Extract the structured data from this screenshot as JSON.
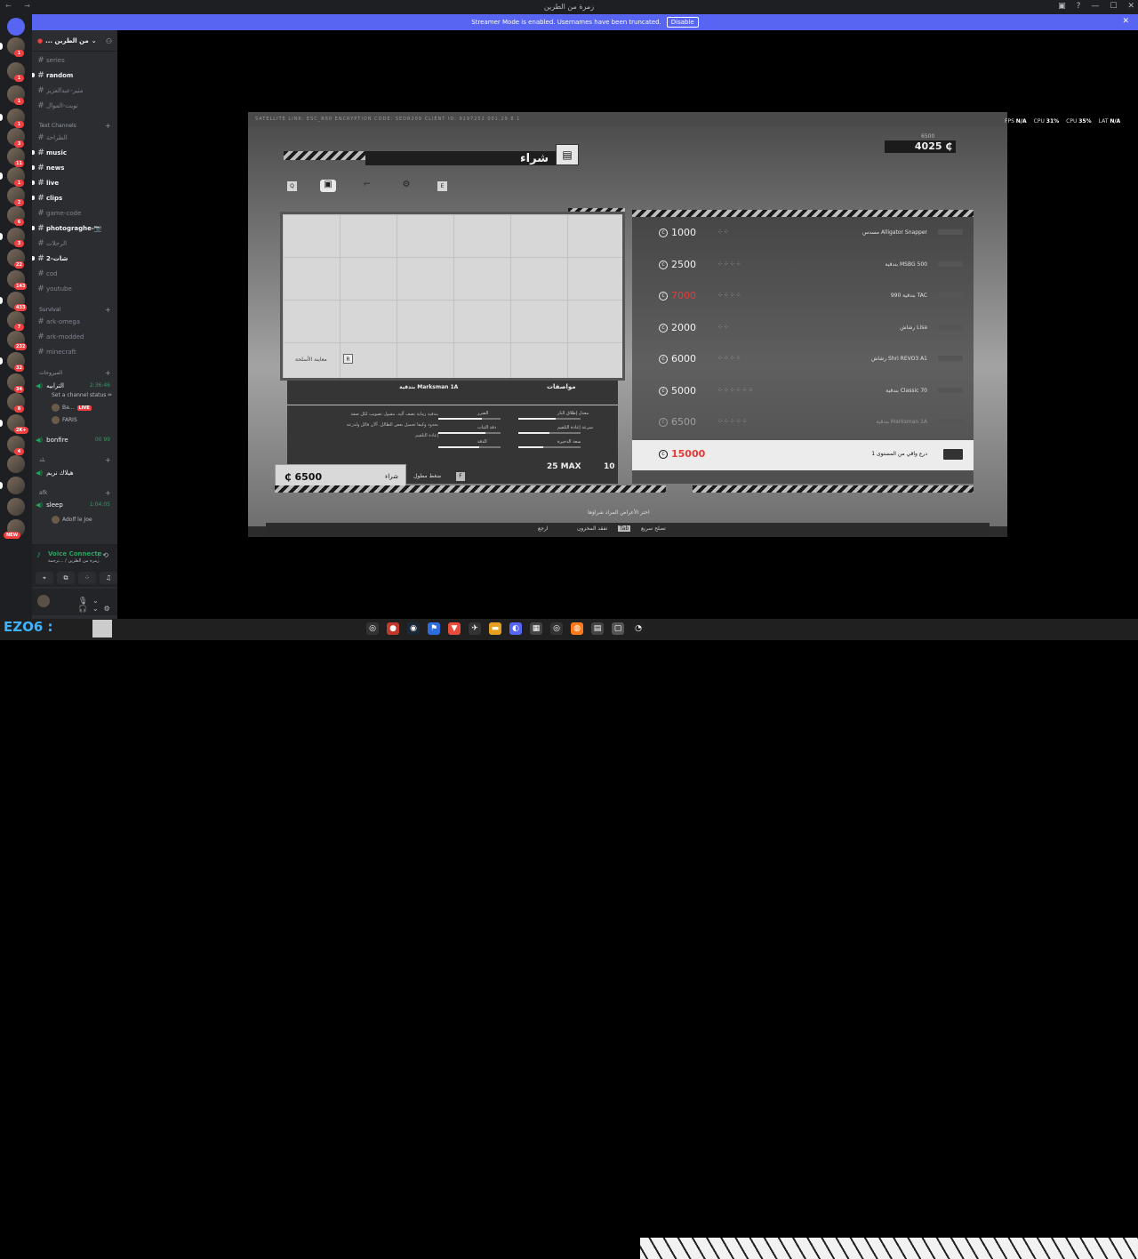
{
  "titlebar": {
    "title": "زمرة من الطرين",
    "nav": "← →"
  },
  "banner": {
    "text": "Streamer Mode is enabled. Usernames have been truncated.",
    "disable_label": "Disable",
    "close": "✕"
  },
  "guild": {
    "name": "... من الطرين"
  },
  "channels_top": [
    {
      "name": "series",
      "unread": false
    },
    {
      "name": "random",
      "unread": true
    },
    {
      "name": "مثير-عبدالعزيز",
      "unread": false
    },
    {
      "name": "تويت-الموال",
      "unread": false
    }
  ],
  "text_category": "Text Channels",
  "channels_text": [
    {
      "name": "الطراحة",
      "unread": false
    },
    {
      "name": "music",
      "unread": true
    },
    {
      "name": "news",
      "unread": true
    },
    {
      "name": "live",
      "unread": true
    },
    {
      "name": "clips",
      "unread": true
    },
    {
      "name": "game-code",
      "unread": false
    },
    {
      "name": "photograghe-📷",
      "unread": true
    },
    {
      "name": "الرحلات",
      "unread": false
    },
    {
      "name": "شات-2",
      "unread": true
    },
    {
      "name": "cod",
      "unread": false
    },
    {
      "name": "youtube",
      "unread": false
    }
  ],
  "survival_category": "Survival",
  "channels_survival": [
    {
      "name": "ark-omega",
      "unread": false
    },
    {
      "name": "ark-modded",
      "unread": false
    },
    {
      "name": "minecraft",
      "unread": false
    }
  ],
  "voice_category": "الميروحات",
  "voice1": {
    "name": "الترابيه",
    "time": "2:36:46",
    "status": "Set a channel status ✏"
  },
  "voice1_users": [
    {
      "name": "Ba...",
      "live": "LIVE"
    },
    {
      "name": "FARIS",
      "live": ""
    }
  ],
  "voice2": {
    "name": "bonfire",
    "time": "00 99"
  },
  "cat2": "بلد",
  "voice3": {
    "name": "هيلاك نريم"
  },
  "cat3": "afk",
  "voice4": {
    "name": "sleep",
    "time": "1:04:05"
  },
  "voice4_user": "Adolf le Joe",
  "voice_panel": {
    "title": "Voice Connecte",
    "sub": "زمرة من الطرين / ...ترجمة"
  },
  "rail_badges": [
    "1",
    "1",
    "1",
    "1",
    "3",
    "11",
    "1",
    "2",
    "6",
    "3",
    "22",
    "143",
    "433",
    "7",
    "232",
    "32",
    "34",
    "8",
    "2K+",
    "4"
  ],
  "rail_new": "NEW",
  "game": {
    "topstrip": "SATELLITE LINK: ESC_R60    ENCRYPTION CODE: SEDR209                                                       CLIENT ID: 9197252    001.29.8.1",
    "buy_label": "شراء",
    "credits": "4025 ₵",
    "credits_prev": "6500",
    "tab_key_left": "Q",
    "tab_key_right": "E",
    "inspect": "معاينة الأسلحة",
    "inspect_key": "R",
    "spec_title": "مواصفات",
    "weapon_name": "بندقية Marksman 1A",
    "desc": "بندقية رماية نصف آلية. مقبول تصويب لكل صفة بحدود وكيفا تحميل بعض الظالل. آلآن قالل ولدرعة إعادة التلقيم",
    "stats": [
      {
        "label": "معدل إطلاق النار",
        "fill": 0.6
      },
      {
        "label": "الضرر",
        "fill": 0.7
      },
      {
        "label": "سرعة إعادة التلقيم",
        "fill": 0.5
      },
      {
        "label": "دقة الثبات",
        "fill": 0.75
      },
      {
        "label": "الدقة",
        "fill": 0.65
      },
      {
        "label": "سعة الذخيرة",
        "fill": 0.4
      }
    ],
    "ammo_mag": "10",
    "ammo_max": "25 MAX",
    "price": "6500",
    "price_label": "شراء",
    "hold_label": "ضغط مطول",
    "hold_key": "F",
    "weapons": [
      {
        "price": "1000",
        "dots": "⁘⁘",
        "name": "مسدس Alligator Snapper",
        "state": "normal"
      },
      {
        "price": "2500",
        "dots": "⁘⁘⁘⁘",
        "name": "بندقية MSBG 500",
        "state": "normal"
      },
      {
        "price": "7000",
        "dots": "⁘⁘⁘⁘",
        "name": "بندقية 990 TAC",
        "state": "red"
      },
      {
        "price": "2000",
        "dots": "⁘⁘",
        "name": "رشاش Lisa",
        "state": "normal"
      },
      {
        "price": "6000",
        "dots": "⁘⁘⁘⁘",
        "name": "رشاش Shri REVO3 A1",
        "state": "normal"
      },
      {
        "price": "5000",
        "dots": "⁘⁘⁘⁘⁘⁘",
        "name": "بندقية Classic 70",
        "state": "normal"
      },
      {
        "price": "6500",
        "dots": "⁘⁘⁘⁘⁘",
        "name": "بندقية Marksman 1A",
        "state": "locked"
      },
      {
        "price": "15000",
        "dots": "",
        "name": "درع واقي من المستوى 1",
        "state": "selected"
      }
    ],
    "hint": "اختر الأعراض المراد شراؤها",
    "bottombar": {
      "back": "ارجع",
      "reload": "تفقد المخزون",
      "tab": "Tab",
      "repair": "تصلح سريع"
    }
  },
  "hud": {
    "fps": "N/A",
    "cpu1": "31%",
    "cpu2": "35%",
    "lat": "N/A"
  },
  "taskbar": {
    "logo": "EZO6 :",
    "user": ""
  },
  "colors": {
    "discord_bg": "#2b2d31",
    "blurple": "#5865f2",
    "green": "#23a55a",
    "red": "#e53b3b"
  }
}
